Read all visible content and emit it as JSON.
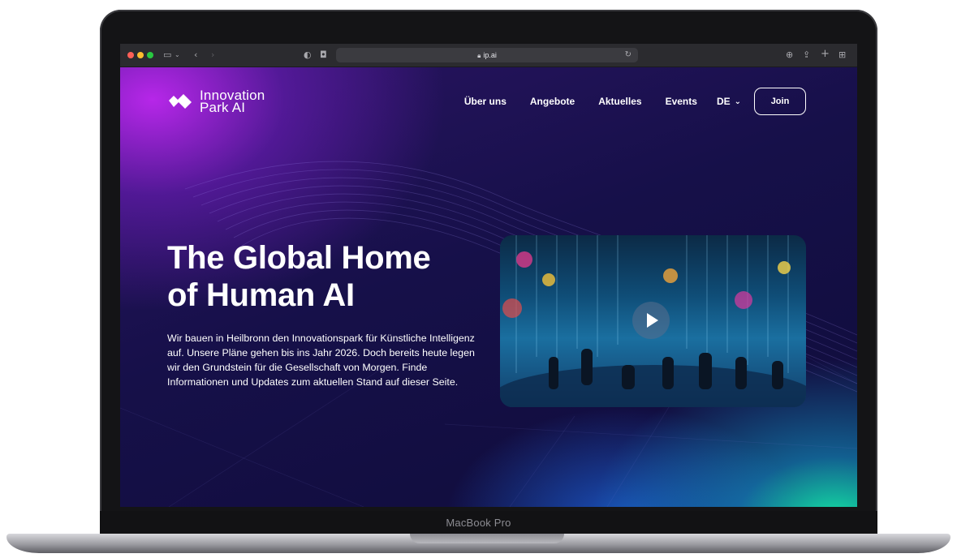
{
  "browser": {
    "url": "ip.ai"
  },
  "site": {
    "logo_line1": "Innovation",
    "logo_line2": "Park AI"
  },
  "nav": {
    "items": [
      "Über uns",
      "Angebote",
      "Aktuelles",
      "Events"
    ],
    "language": "DE",
    "join_label": "Join"
  },
  "hero": {
    "title_line1": "The Global Home",
    "title_line2": "of Human AI",
    "body": "Wir bauen in Heilbronn den Innovationspark für Künstliche Intelligenz auf. Unsere Pläne gehen bis ins Jahr 2026. Doch bereits heute legen wir den Grundstein für die Gesellschaft von Morgen. Finde Informationen und Updates zum aktuellen Stand auf dieser Seite."
  },
  "device": {
    "model_label": "MacBook Pro"
  },
  "colors": {
    "accent_purple": "#b51fe0",
    "accent_green": "#17e8a8",
    "background": "#161049"
  },
  "icons": {
    "play": "play-icon",
    "chevron": "chevron-down-icon",
    "lock": "lock-icon"
  }
}
